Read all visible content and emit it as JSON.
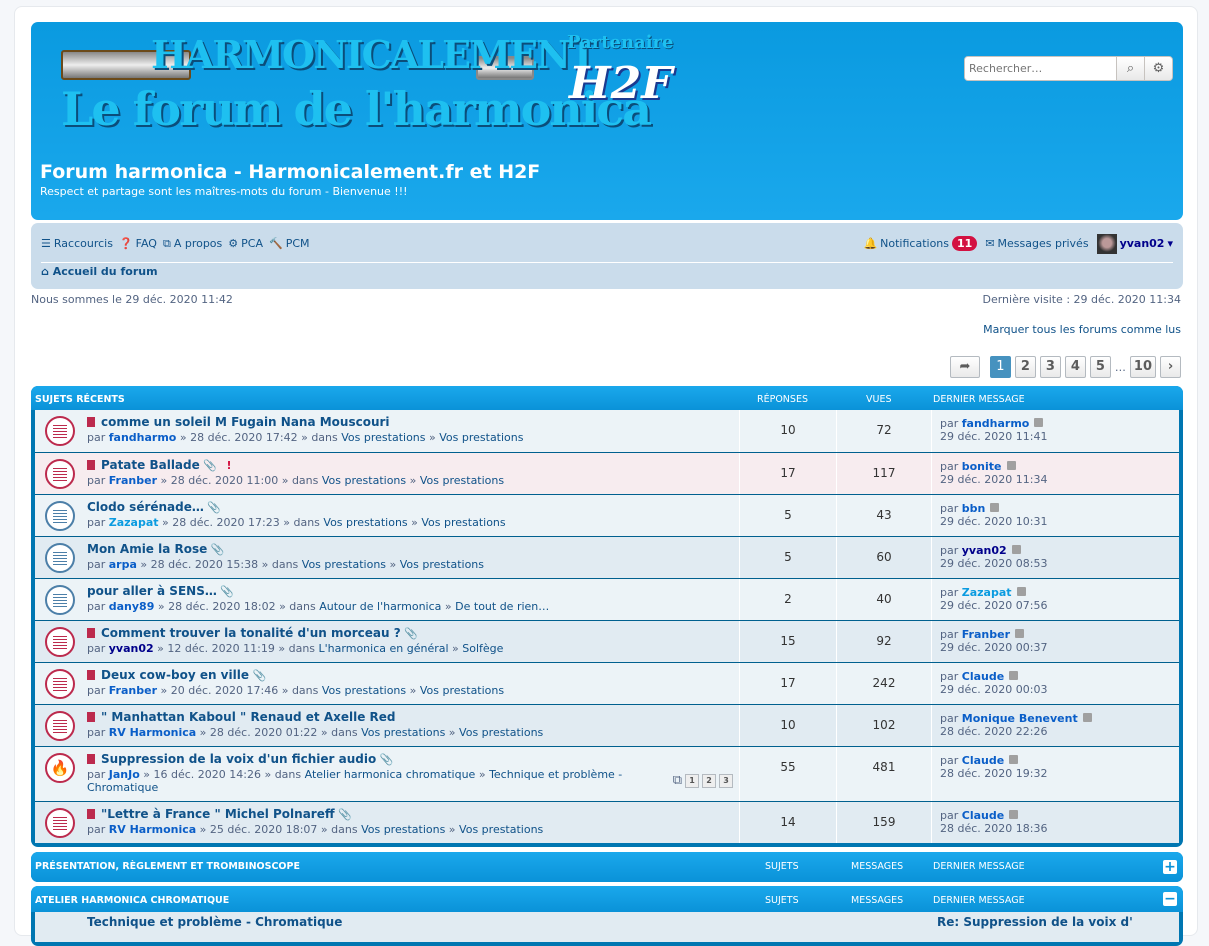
{
  "header": {
    "logo_text": "HARMONICALEMENT",
    "logo_subtitle": "Le forum de l'harmonica",
    "partner_text": "Partenaire",
    "partner_logo": "H2F Harmonicas De France Fédération",
    "site_title": "Forum harmonica - Harmonicalement.fr et H2F",
    "site_description": "Respect et partage sont les maîtres-mots du forum - Bienvenue !!!",
    "search_placeholder": "Rechercher…"
  },
  "nav": {
    "items": [
      {
        "icon": "bars-icon",
        "label": "Raccourcis"
      },
      {
        "icon": "question-icon",
        "label": "FAQ"
      },
      {
        "icon": "copy-icon",
        "label": "A propos"
      },
      {
        "icon": "gears-icon",
        "label": "PCA"
      },
      {
        "icon": "gavel-icon",
        "label": "PCM"
      }
    ],
    "notifications_label": "Notifications",
    "notifications_count": "11",
    "pm_label": "Messages privés",
    "username": "yvan02",
    "breadcrumb": "Accueil du forum"
  },
  "info": {
    "now": "Nous sommes le 29 déc. 2020 11:42",
    "last_visit": "Dernière visite : 29 déc. 2020 11:34",
    "mark_all": "Marquer tous les forums comme lus"
  },
  "pagination": {
    "pages": [
      "1",
      "2",
      "3",
      "4",
      "5"
    ],
    "ellipsis": "…",
    "last": "10",
    "current": "1"
  },
  "recent": {
    "title": "SUJETS RÉCENTS",
    "col_replies": "RÉPONSES",
    "col_views": "VUES",
    "col_last": "DERNIER MESSAGE",
    "by": "par",
    "topics": [
      {
        "title": "comme un soleil M Fugain Nana Mouscouri",
        "author": "fandharmo",
        "author_color": "#0a5ec8",
        "date": "28 déc. 2020 17:42",
        "forum1": "Vos prestations",
        "forum2": "Vos prestations",
        "replies": "10",
        "views": "72",
        "last_user": "fandharmo",
        "last_color": "#0a5ec8",
        "last_date": "29 déc. 2020 11:41",
        "unread": true,
        "attach": false,
        "reported": false,
        "hot": false
      },
      {
        "title": "Patate Ballade",
        "author": "Franber",
        "author_color": "#0a5ec8",
        "date": "28 déc. 2020 11:00",
        "forum1": "Vos prestations",
        "forum2": "Vos prestations",
        "replies": "17",
        "views": "117",
        "last_user": "bonite",
        "last_color": "#0a5ec8",
        "last_date": "29 déc. 2020 11:34",
        "unread": true,
        "attach": true,
        "reported": true,
        "hot": false
      },
      {
        "title": "Clodo sérénade…",
        "author": "Zazapat",
        "author_color": "#0a9be0",
        "date": "28 déc. 2020 17:23",
        "forum1": "Vos prestations",
        "forum2": "Vos prestations",
        "replies": "5",
        "views": "43",
        "last_user": "bbn",
        "last_color": "#0a5ec8",
        "last_date": "29 déc. 2020 10:31",
        "unread": false,
        "attach": true,
        "reported": false,
        "hot": false
      },
      {
        "title": "Mon Amie la Rose",
        "author": "arpa",
        "author_color": "#0a5ec8",
        "date": "28 déc. 2020 15:38",
        "forum1": "Vos prestations",
        "forum2": "Vos prestations",
        "replies": "5",
        "views": "60",
        "last_user": "yvan02",
        "last_color": "#00008b",
        "last_date": "29 déc. 2020 08:53",
        "unread": false,
        "attach": true,
        "reported": false,
        "hot": false
      },
      {
        "title": "pour aller à SENS…",
        "author": "dany89",
        "author_color": "#0a5ec8",
        "date": "28 déc. 2020 18:02",
        "forum1": "Autour de l'harmonica",
        "forum2": "De tout de rien…",
        "replies": "2",
        "views": "40",
        "last_user": "Zazapat",
        "last_color": "#0a9be0",
        "last_date": "29 déc. 2020 07:56",
        "unread": false,
        "attach": true,
        "reported": false,
        "hot": false
      },
      {
        "title": "Comment trouver la tonalité d'un morceau ?",
        "author": "yvan02",
        "author_color": "#00008b",
        "date": "12 déc. 2020 11:19",
        "forum1": "L'harmonica en général",
        "forum2": "Solfège",
        "replies": "15",
        "views": "92",
        "last_user": "Franber",
        "last_color": "#0a5ec8",
        "last_date": "29 déc. 2020 00:37",
        "unread": true,
        "attach": true,
        "reported": false,
        "hot": false
      },
      {
        "title": "Deux cow-boy en ville",
        "author": "Franber",
        "author_color": "#0a5ec8",
        "date": "20 déc. 2020 17:46",
        "forum1": "Vos prestations",
        "forum2": "Vos prestations",
        "replies": "17",
        "views": "242",
        "last_user": "Claude",
        "last_color": "#0a5ec8",
        "last_date": "29 déc. 2020 00:03",
        "unread": true,
        "attach": true,
        "reported": false,
        "hot": false
      },
      {
        "title": "\" Manhattan Kaboul \" Renaud et Axelle Red",
        "author": "RV Harmonica",
        "author_color": "#0a5ec8",
        "date": "28 déc. 2020 01:22",
        "forum1": "Vos prestations",
        "forum2": "Vos prestations",
        "replies": "10",
        "views": "102",
        "last_user": "Monique Benevent",
        "last_color": "#0a5ec8",
        "last_date": "28 déc. 2020 22:26",
        "unread": true,
        "attach": false,
        "reported": false,
        "hot": false
      },
      {
        "title": "Suppression de la voix d'un fichier audio",
        "author": "JanJo",
        "author_color": "#0a5ec8",
        "date": "16 déc. 2020 14:26",
        "forum1": "Atelier harmonica chromatique",
        "forum2": "Technique et problème - Chromatique",
        "replies": "55",
        "views": "481",
        "last_user": "Claude",
        "last_color": "#0a5ec8",
        "last_date": "28 déc. 2020 19:32",
        "unread": true,
        "attach": true,
        "reported": false,
        "hot": true,
        "pages": [
          "1",
          "2",
          "3"
        ]
      },
      {
        "title": "\"Lettre à France \" Michel Polnareff",
        "author": "RV Harmonica",
        "author_color": "#0a5ec8",
        "date": "25 déc. 2020 18:07",
        "forum1": "Vos prestations",
        "forum2": "Vos prestations",
        "replies": "14",
        "views": "159",
        "last_user": "Claude",
        "last_color": "#0a5ec8",
        "last_date": "28 déc. 2020 18:36",
        "unread": true,
        "attach": true,
        "reported": false,
        "hot": false
      }
    ]
  },
  "categories": [
    {
      "title": "PRÉSENTATION, RÈGLEMENT ET TROMBINOSCOPE",
      "col_topics": "SUJETS",
      "col_posts": "MESSAGES",
      "col_last": "DERNIER MESSAGE",
      "toggle": "+"
    },
    {
      "title": "ATELIER HARMONICA CHROMATIQUE",
      "col_topics": "SUJETS",
      "col_posts": "MESSAGES",
      "col_last": "DERNIER MESSAGE",
      "toggle": "−",
      "first_forum": "Technique et problème - Chromatique",
      "first_last": "Re: Suppression de la voix d'"
    }
  ],
  "colors": {
    "header": "#12a0e6",
    "navbar": "#cadceb",
    "unread": "#bc2a4d",
    "row_a": "#ecf3f7",
    "row_b": "#e1ebf2",
    "row_reported": "#f7ecef"
  }
}
